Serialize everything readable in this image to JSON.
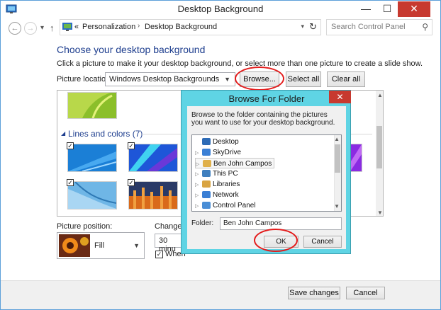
{
  "window": {
    "title": "Desktop Background",
    "minimize": "—",
    "maximize": "☐",
    "close": "✕"
  },
  "nav": {
    "back": "←",
    "forward": "→",
    "dropdown": "▾",
    "up": "↑"
  },
  "address": {
    "overflow": "«",
    "crumbs": [
      "Personalization",
      "Desktop Background"
    ],
    "separator": "›",
    "dropdown": "▾",
    "refresh": "↻"
  },
  "search": {
    "placeholder": "Search Control Panel",
    "icon": "⚲"
  },
  "main": {
    "heading": "Choose your desktop background",
    "subtext": "Click a picture to make it your desktop background, or select more than one picture to create a slide show.",
    "picture_location_label": "Picture location:",
    "picture_location_value": "Windows Desktop Backgrounds",
    "browse_label": "Browse...",
    "select_all_label": "Select all",
    "clear_all_label": "Clear all",
    "group_label": "Lines and colors (7)",
    "group_caret": "◢",
    "check_mark": "✓",
    "picture_position_label": "Picture position:",
    "picture_position_value": "Fill",
    "change_picture_label": "Change p",
    "change_interval_value": "30 minu",
    "when_label": "When",
    "save_label": "Save changes",
    "cancel_label": "Cancel"
  },
  "dialog": {
    "title": "Browse For Folder",
    "close": "✕",
    "description": "Browse to the folder containing the pictures you want to use for your desktop background.",
    "tree": [
      {
        "label": "Desktop",
        "icon": "desktop-icon",
        "expander": "",
        "color": "#2d6bb6"
      },
      {
        "label": "SkyDrive",
        "icon": "skydrive-icon",
        "expander": "▷",
        "color": "#3a7fd5"
      },
      {
        "label": "Ben John Campos",
        "icon": "user-folder-icon",
        "expander": "▷",
        "color": "#e0b04a"
      },
      {
        "label": "This PC",
        "icon": "computer-icon",
        "expander": "▷",
        "color": "#3f7fbf"
      },
      {
        "label": "Libraries",
        "icon": "library-icon",
        "expander": "▷",
        "color": "#d9a441"
      },
      {
        "label": "Network",
        "icon": "network-icon",
        "expander": "▷",
        "color": "#3a7fd5"
      },
      {
        "label": "Control Panel",
        "icon": "control-panel-icon",
        "expander": "▷",
        "color": "#4a8ed6"
      }
    ],
    "folder_label": "Folder:",
    "folder_value": "Ben John Campos",
    "ok_label": "OK",
    "cancel_label": "Cancel"
  },
  "colors": {
    "accent": "#1f3f8f",
    "dialog_frame": "#5fd4e4",
    "close_red": "#c7392f",
    "highlight_ring": "#e31b1b"
  }
}
